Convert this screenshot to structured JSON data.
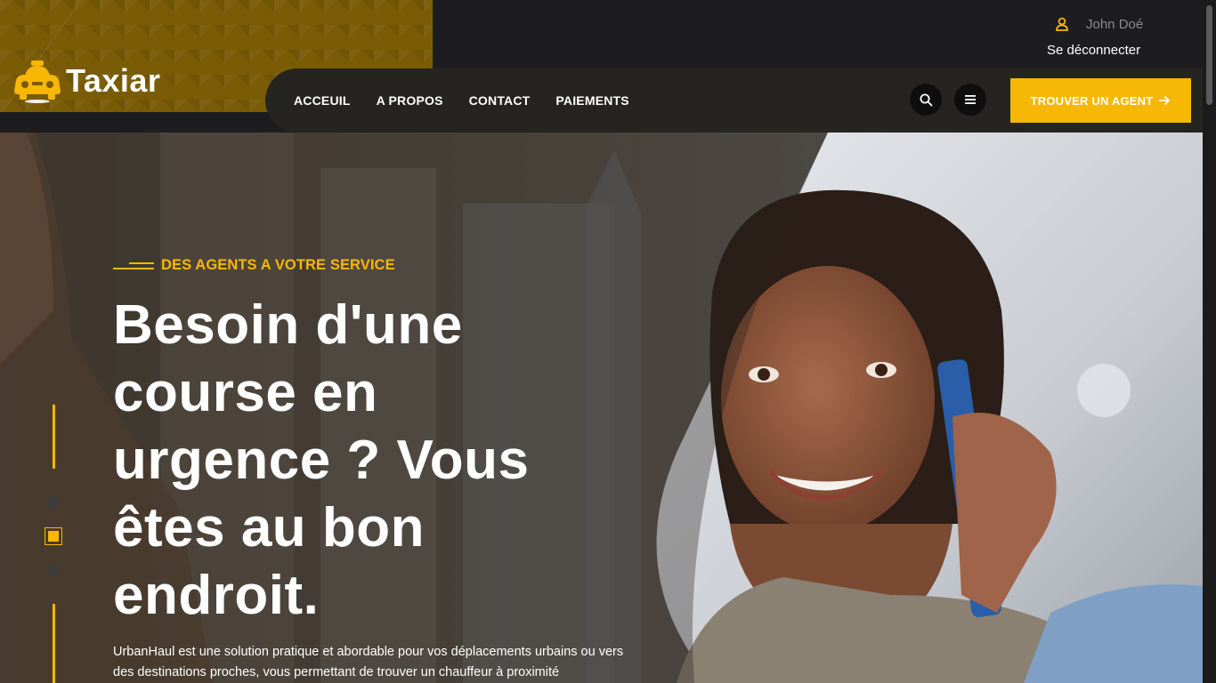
{
  "brand": {
    "name": "Taxiar",
    "logo_icon": "taxi-car-icon",
    "accent_color": "#f7b705"
  },
  "user": {
    "name": "John Doé",
    "icon": "user-icon",
    "logout_label": "Se déconnecter"
  },
  "nav": {
    "items": [
      {
        "label": "ACCEUIL"
      },
      {
        "label": "A PROPOS"
      },
      {
        "label": "CONTACT"
      },
      {
        "label": "PAIEMENTS"
      }
    ],
    "search_icon": "search-icon",
    "menu_icon": "hamburger-menu-icon",
    "cta_label": "TROUVER UN AGENT",
    "cta_icon": "arrow-right-icon"
  },
  "hero": {
    "subtitle": "DES AGENTS A VOTRE SERVICE",
    "headline": "Besoin d'une course en urgence ? Vous êtes au bon endroit.",
    "description": "UrbanHaul est une solution pratique et abordable pour vos déplacements urbains ou vers des destinations proches, vous permettant de trouver un chauffeur à proximité",
    "slides_count": 3,
    "active_slide": 2
  }
}
